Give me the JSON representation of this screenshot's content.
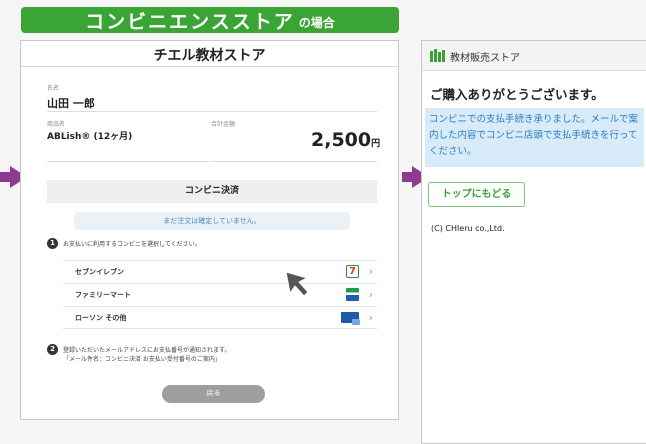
{
  "banner": {
    "main": "コンビニエンスストア",
    "sub": "の場合"
  },
  "left": {
    "store_title": "チエル教材ストア",
    "name_label": "氏名",
    "name_value": "山田 一郎",
    "product_label": "商品名",
    "product_value": "ABLish® (12ヶ月)",
    "amount_label": "合計金額",
    "amount_value": "2,500",
    "amount_unit": "円",
    "section_title": "コンビニ決済",
    "notice": "まだ注文は確定していません。",
    "step1_num": "1",
    "step1_text": "お支払いに利用するコンビニを選択してください。",
    "stores": [
      {
        "name": "セブンイレブン",
        "logo_text": "7"
      },
      {
        "name": "ファミリーマート"
      },
      {
        "name": "ローソン その他"
      }
    ],
    "chevron": "›",
    "step2_num": "2",
    "step2_line1": "登録いただいたメールアドレスにお支払番号が通知されます。",
    "step2_line2": "「メール件名：コンビニ決済 お支払い受付番号のご案内」",
    "back_label": "戻る"
  },
  "right": {
    "header_title": "教材販売ストア",
    "thanks": "ご購入ありがとうございます。",
    "info": "コンビニでの支払手続き承りました。メールで案内した内容でコンビニ店頭で支払手続きを行ってください。",
    "top_button": "トップにもどる",
    "copyright": "(C) CHIeru co.,Ltd."
  },
  "colors": {
    "brand_green": "#3aa535",
    "arrow_purple": "#8e3a8f",
    "info_blue": "#2c7bc4"
  }
}
